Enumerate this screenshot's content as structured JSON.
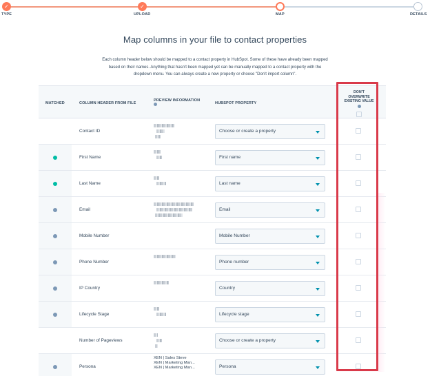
{
  "stepper": {
    "steps": [
      {
        "label": "TYPE",
        "state": "done"
      },
      {
        "label": "UPLOAD",
        "state": "done"
      },
      {
        "label": "MAP",
        "state": "current"
      },
      {
        "label": "DETAILS",
        "state": "todo"
      }
    ],
    "check_glyph": "✓"
  },
  "page": {
    "title": "Map columns in your file to contact properties",
    "description_lines": [
      "Each column header below should be mapped to a contact property in HubSpot. Some of these have already been mapped",
      "based on their names. Anything that hasn't been mapped yet can be manually mapped to a contact property with the",
      "dropdown menu. You can always create a new property or choose \"Don't import column\"."
    ]
  },
  "table": {
    "headers": {
      "matched": "MATCHED",
      "column_header": "COLUMN HEADER FROM FILE",
      "preview": "PREVIEW INFORMATION",
      "property": "HUBSPOT PROPERTY",
      "dont_overwrite_lines": [
        "DON'T",
        "OVERWRITE",
        "EXISTING VALUE"
      ]
    },
    "rows": [
      {
        "header": "Contact ID",
        "match": "none",
        "property": "Choose or create a property",
        "preview_text": [],
        "blur_widths": [
          30,
          12,
          8
        ]
      },
      {
        "header": "First Name",
        "match": "green",
        "property": "First name",
        "preview_text": [],
        "blur_widths": [
          10,
          8
        ]
      },
      {
        "header": "Last Name",
        "match": "green",
        "property": "Last name",
        "preview_text": [],
        "blur_widths": [
          8,
          14
        ]
      },
      {
        "header": "Email",
        "match": "gray",
        "property": "Email",
        "preview_text": [],
        "blur_widths": [
          58,
          52,
          40
        ]
      },
      {
        "header": "Mobile Number",
        "match": "gray",
        "property": "Mobile Number",
        "preview_text": [],
        "blur_widths": []
      },
      {
        "header": "Phone Number",
        "match": "gray",
        "property": "Phone number",
        "preview_text": [],
        "blur_widths": [
          32
        ]
      },
      {
        "header": "IP Country",
        "match": "gray",
        "property": "Country",
        "preview_text": [],
        "blur_widths": [
          22
        ]
      },
      {
        "header": "Lifecycle Stage",
        "match": "gray",
        "property": "Lifecycle stage",
        "preview_text": [],
        "blur_widths": [
          8,
          14
        ]
      },
      {
        "header": "Number of Pageviews",
        "match": "none",
        "property": "Choose or create a property",
        "preview_text": [],
        "blur_widths": [
          6,
          8,
          4
        ]
      },
      {
        "header": "Persona",
        "match": "gray",
        "property": "Persona",
        "preview_text": [
          "XEN | Sales Steve",
          "XEN | Marketing Man...",
          "XEN | Marketing Man..."
        ],
        "blur_widths": []
      }
    ]
  },
  "colors": {
    "accent": "#ff7a59",
    "highlight": "#d93a4a",
    "matched_green": "#00bda5",
    "matched_gray": "#7c98b6",
    "link_caret": "#0091ae"
  }
}
